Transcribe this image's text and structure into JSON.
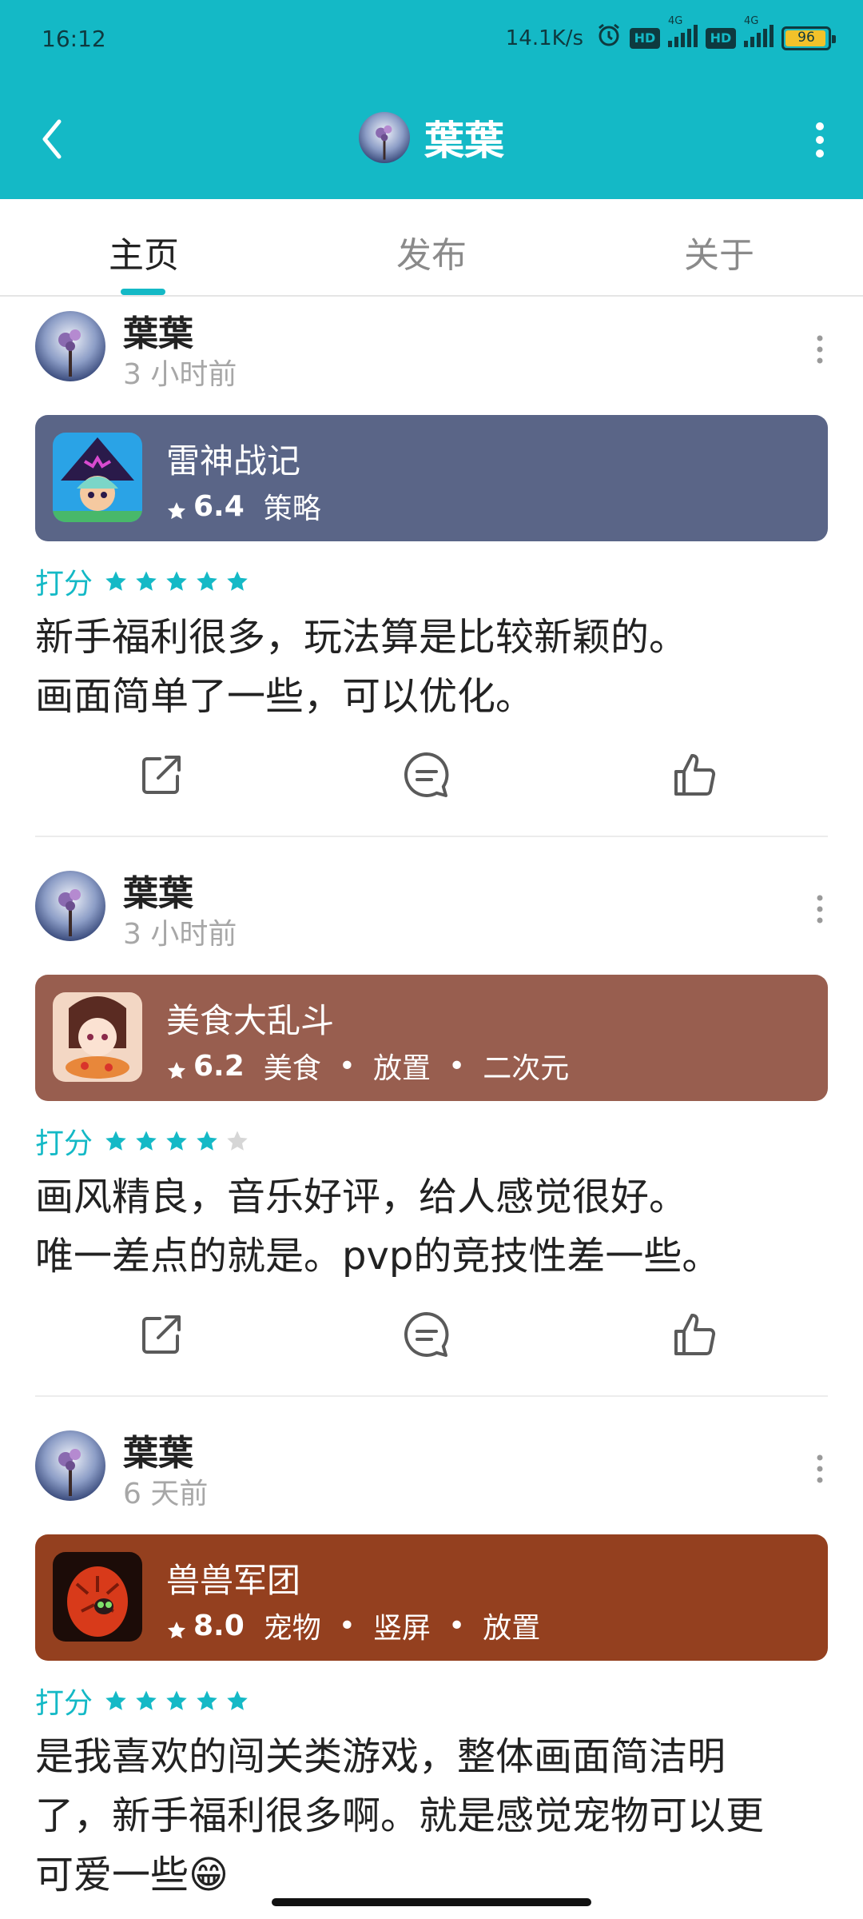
{
  "status_bar": {
    "time": "16:12",
    "net_speed": "14.1K/s",
    "hd": "HD",
    "net_type": "4G",
    "battery": "96"
  },
  "nav": {
    "title": "葉葉"
  },
  "tabs": [
    {
      "label": "主页",
      "active": true
    },
    {
      "label": "发布",
      "active": false
    },
    {
      "label": "关于",
      "active": false
    }
  ],
  "posts": [
    {
      "author": "葉葉",
      "time_ago": "3 小时前",
      "game": {
        "name": "雷神战记",
        "score": "6.4",
        "tags": [
          "策略"
        ],
        "color": "#5a6587"
      },
      "rating_label": "打分",
      "rating": 5,
      "review_lines": [
        "新手福利很多，玩法算是比较新颖的。",
        "画面简单了一些，可以优化。"
      ]
    },
    {
      "author": "葉葉",
      "time_ago": "3 小时前",
      "game": {
        "name": "美食大乱斗",
        "score": "6.2",
        "tags": [
          "美食",
          "放置",
          "二次元"
        ],
        "color": "#985e4f"
      },
      "rating_label": "打分",
      "rating": 4,
      "review_lines": [
        "画风精良，音乐好评，给人感觉很好。",
        "唯一差点的就是。pvp的竞技性差一些。"
      ]
    },
    {
      "author": "葉葉",
      "time_ago": "6 天前",
      "game": {
        "name": "兽兽军团",
        "score": "8.0",
        "tags": [
          "宠物",
          "竖屏",
          "放置"
        ],
        "color": "#94401f"
      },
      "rating_label": "打分",
      "rating": 5,
      "review_lines": [
        "是我喜欢的闯关类游戏，整体画面简洁明",
        "了，新手福利很多啊。就是感觉宠物可以更",
        "可爱一些😁"
      ]
    }
  ],
  "colors": {
    "accent": "#14b9c6",
    "star_empty": "#d6d6d6"
  }
}
